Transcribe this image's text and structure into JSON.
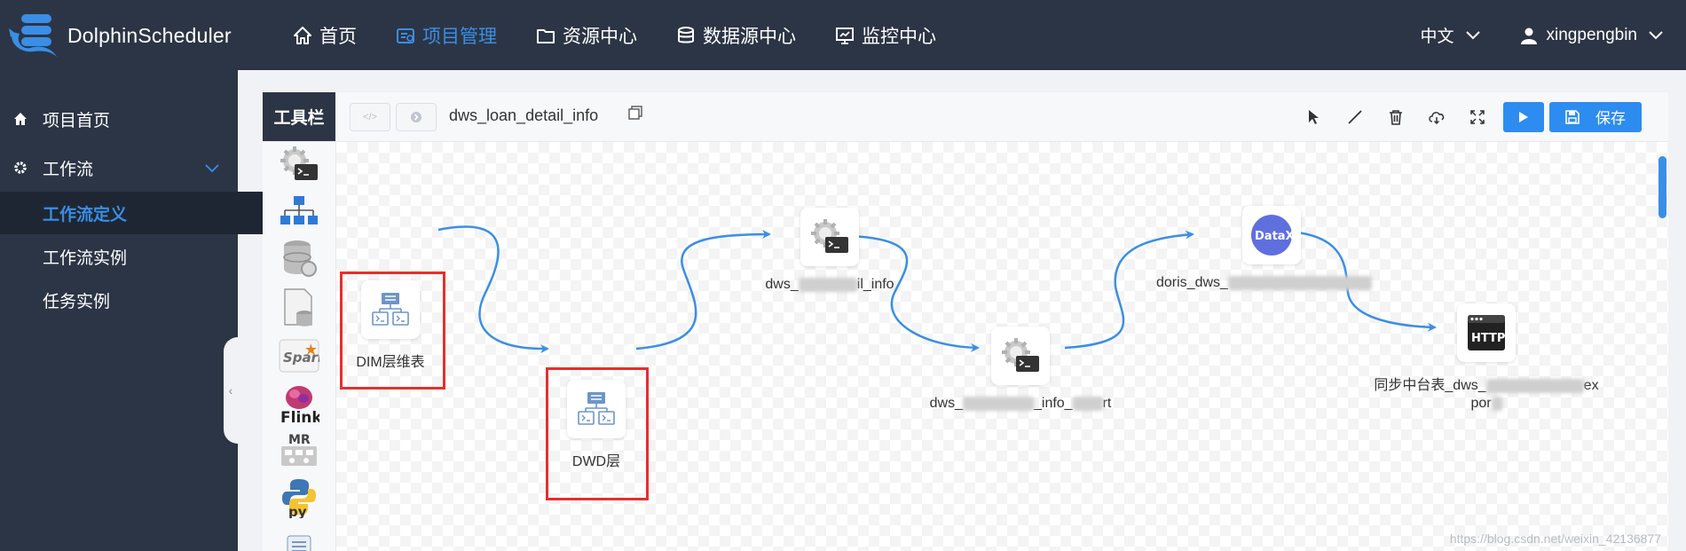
{
  "app": {
    "name": "DolphinScheduler"
  },
  "nav": {
    "items": [
      {
        "label": "首页",
        "icon": "home-icon"
      },
      {
        "label": "项目管理",
        "icon": "project-icon",
        "active": true
      },
      {
        "label": "资源中心",
        "icon": "folder-icon"
      },
      {
        "label": "数据源中心",
        "icon": "database-icon"
      },
      {
        "label": "监控中心",
        "icon": "monitor-icon"
      }
    ],
    "language": "中文",
    "user": "xingpengbin"
  },
  "sidebar": {
    "items": [
      {
        "label": "项目首页",
        "icon": "home-icon"
      },
      {
        "label": "工作流",
        "icon": "gear-icon"
      },
      {
        "label": "工作流定义",
        "active": true
      },
      {
        "label": "工作流实例"
      },
      {
        "label": "任务实例"
      }
    ]
  },
  "toolbar": {
    "title": "工具栏",
    "workflow_name": "dws_loan_detail_info",
    "save_label": "保存"
  },
  "palette": [
    "shell",
    "sub-process",
    "procedure",
    "sql",
    "spark",
    "flink",
    "mr",
    "python",
    "dependent"
  ],
  "colors": {
    "accent": "#3a8ee6",
    "nav_bg": "#2c3545",
    "highlight": "#e62e2e",
    "edge": "#3a8ee6"
  },
  "nodes": [
    {
      "id": "n1",
      "type": "sub-process",
      "label": "DIM层维表",
      "highlighted": true
    },
    {
      "id": "n2",
      "type": "sub-process",
      "label": "DWD层",
      "highlighted": true
    },
    {
      "id": "n3",
      "type": "shell",
      "label_pre": "dws_",
      "label_post": "il_info"
    },
    {
      "id": "n4",
      "type": "shell",
      "label_pre": "dws_",
      "label_mid": "_info_",
      "label_post": "rt"
    },
    {
      "id": "n5",
      "type": "datax",
      "label_pre": "doris_dws_",
      "icon_text": "DataX"
    },
    {
      "id": "n6",
      "type": "http",
      "label_pre": "同步中台表_dws_",
      "label_post": "ex",
      "label_line2": "por",
      "icon_text": "HTTP"
    }
  ],
  "watermark": "https://blog.csdn.net/weixin_42136877"
}
